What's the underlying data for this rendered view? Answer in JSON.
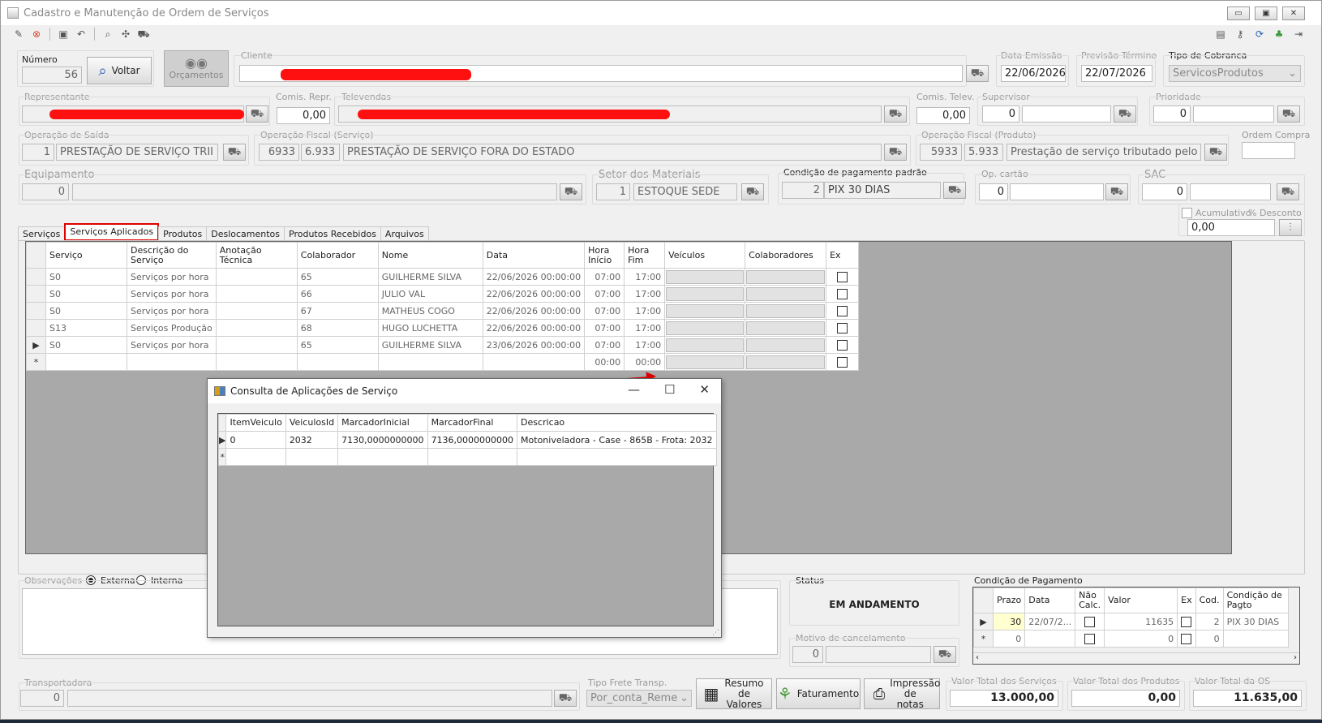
{
  "window": {
    "title": "Cadastro e Manutenção de Ordem de Serviços",
    "btn_min": "▭",
    "btn_max": "▣",
    "btn_close": "✕"
  },
  "header": {
    "numero_label": "Número",
    "numero_value": "56",
    "voltar_label": "Voltar",
    "orcamentos_label": "Orçamentos",
    "cliente_label": "Cliente",
    "data_emissao_label": "Data Emissão",
    "data_emissao": "22/06/2026",
    "previsao_label": "Previsão Término",
    "previsao": "22/07/2026",
    "tipo_cobranca_label": "Tipo de Cobranca",
    "tipo_cobranca": "ServicosProdutos",
    "representante_label": "Representante",
    "comis_repr_label": "Comis. Repr.",
    "comis_repr": "0,00",
    "televendas_label": "Televendas",
    "comis_telev_label": "Comis. Telev.",
    "comis_telev": "0,00",
    "supervisor_label": "Supervisor",
    "supervisor": "0",
    "prioridade_label": "Prioridade",
    "prioridade": "0",
    "op_saida_label": "Operação de Saída",
    "op_saida_code": "1",
    "op_saida": "PRESTAÇÃO DE SERVIÇO TRII",
    "op_fiscal_serv_label": "Operação Fiscal (Serviço)",
    "op_fiscal_serv_code": "6933",
    "op_fiscal_serv_cfop": "6.933",
    "op_fiscal_serv": "PRESTAÇÃO DE SERVIÇO FORA DO ESTADO",
    "op_fiscal_prod_label": "Operação Fiscal (Produto)",
    "op_fiscal_prod_code": "5933",
    "op_fiscal_prod_cfop": "5.933",
    "op_fiscal_prod": "Prestação de serviço tributado pelo ISS",
    "ordem_compra_label": "Ordem Compra",
    "equipamento_label": "Equipamento",
    "equipamento": "0",
    "setor_label": "Setor dos Materiais",
    "setor_code": "1",
    "setor": "ESTOQUE SEDE",
    "cond_pag_label": "Condição de pagamento padrão",
    "cond_pag_code": "2",
    "cond_pag": "PIX 30 DIAS",
    "op_cartao_label": "Op. cartão",
    "op_cartao": "0",
    "sac_label": "SAC",
    "sac": "0",
    "acumulativo_label": "Acumulativo",
    "desconto_label": "% Desconto",
    "desconto": "0,00"
  },
  "tabs": [
    "Serviços",
    "Serviços Aplicados",
    "Produtos",
    "Deslocamentos",
    "Produtos Recebidos",
    "Arquivos"
  ],
  "grid": {
    "headers": [
      "Serviço",
      "Descrição do Serviço",
      "Anotação Técnica",
      "Colaborador",
      "Nome",
      "Data",
      "Hora Início",
      "Hora Fim",
      "Veículos",
      "Colaboradores",
      "Ex"
    ],
    "rows": [
      {
        "servico": "S0",
        "descricao": "Serviços por hora",
        "anotacao": "",
        "colab": "65",
        "nome": "GUILHERME SILVA",
        "data": "22/06/2026 00:00:00",
        "hi": "07:00",
        "hf": "17:00"
      },
      {
        "servico": "S0",
        "descricao": "Serviços por hora",
        "anotacao": "",
        "colab": "66",
        "nome": "JULIO VAL",
        "data": "22/06/2026 00:00:00",
        "hi": "07:00",
        "hf": "17:00"
      },
      {
        "servico": "S0",
        "descricao": "Serviços por hora",
        "anotacao": "",
        "colab": "67",
        "nome": "MATHEUS COGO",
        "data": "22/06/2026 00:00:00",
        "hi": "07:00",
        "hf": "17:00"
      },
      {
        "servico": "S13",
        "descricao": "Serviços Produção",
        "anotacao": "",
        "colab": "68",
        "nome": "HUGO LUCHETTA",
        "data": "22/06/2026 00:00:00",
        "hi": "07:00",
        "hf": "17:00"
      },
      {
        "servico": "S0",
        "descricao": "Serviços por hora",
        "anotacao": "",
        "colab": "65",
        "nome": "GUILHERME SILVA",
        "data": "23/06/2026 00:00:00",
        "hi": "07:00",
        "hf": "17:00"
      }
    ],
    "new_row": {
      "hi": "00:00",
      "hf": "00:00"
    }
  },
  "dialog": {
    "title": "Consulta de Aplicações de Serviço",
    "headers": [
      "ItemVeiculo",
      "VeiculosId",
      "MarcadorInicial",
      "MarcadorFinal",
      "Descricao"
    ],
    "rows": [
      {
        "item": "0",
        "vid": "2032",
        "mi": "7130,0000000000",
        "mf": "7136,0000000000",
        "desc": "Motoniveladora - Case - 865B - Frota: 2032"
      }
    ]
  },
  "obs": {
    "label": "Observações",
    "externa": "Externa",
    "interna": "Interna"
  },
  "status": {
    "label": "Status",
    "value": "EM ANDAMENTO",
    "motivo_label": "Motivo de cancelamento",
    "motivo_code": "0"
  },
  "pagamento": {
    "label": "Condição de Pagamento",
    "headers": [
      "Prazo",
      "Data",
      "Não Calc.",
      "Valor",
      "Ex",
      "Cod.",
      "Condição de Pagto"
    ],
    "row": {
      "prazo": "30",
      "data": "22/07/2...",
      "valor": "11635",
      "cod": "2",
      "cond": "PIX 30 DIAS"
    },
    "new_row": {
      "prazo": "0",
      "valor": "0",
      "cod": "0"
    }
  },
  "footer": {
    "transportadora_label": "Transportadora",
    "transportadora": "0",
    "frete_label": "Tipo Frete Transp.",
    "frete": "Por_conta_Reme",
    "resumo_label": "Resumo de Valores",
    "faturamento_label": "Faturamento",
    "impressao_label": "Impressão de notas",
    "vt_serv_label": "Valor Total dos Serviços",
    "vt_serv": "13.000,00",
    "vt_prod_label": "Valor Total dos Produtos",
    "vt_prod": "0,00",
    "vt_os_label": "Valor Total da OS",
    "vt_os": "11.635,00"
  },
  "colors": {
    "accent_red": "#e00000",
    "redaction": "#ff1010",
    "grid_bg": "#a9a9a9"
  }
}
